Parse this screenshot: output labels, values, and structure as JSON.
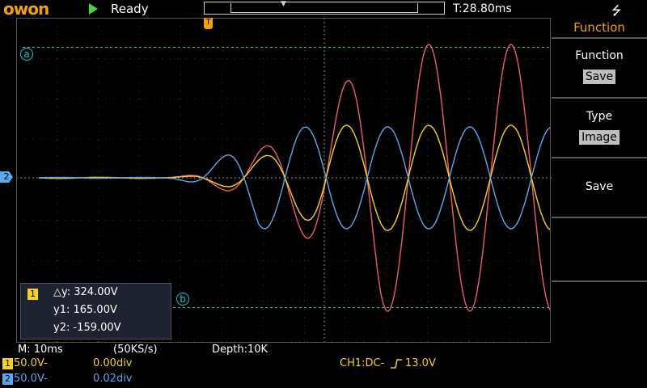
{
  "topbar": {
    "logo": "owon",
    "status": "Ready",
    "trigger_position_marker": "▼",
    "trigger_time": "T:28.80ms",
    "usb_icon": "usb-icon"
  },
  "menu": {
    "title": "Function",
    "items": [
      {
        "label": "Function",
        "value": "Save"
      },
      {
        "label": "Type",
        "value": "Image"
      },
      {
        "label": "Save",
        "value": ""
      }
    ]
  },
  "cursors": {
    "a_label": "a",
    "b_label": "b",
    "trigger_marker": "T",
    "ch2_marker": "2"
  },
  "measurement": {
    "channel": "1",
    "delta": "△y: 324.00V",
    "y1": "y1: 165.00V",
    "y2": "y2: -159.00V"
  },
  "status_line": {
    "timebase": "M: 10ms",
    "sample_rate": "(50KS/s)",
    "depth": "Depth:10K"
  },
  "channels": [
    {
      "id": "1",
      "scale": "50.0V-",
      "offset": "0.00div",
      "color": "#f7d21f"
    },
    {
      "id": "2",
      "scale": "50.0V-",
      "offset": "0.02div",
      "color": "#5aa9f0"
    }
  ],
  "trigger": {
    "text_prefix": "CH1:DC-",
    "text_value": "13.0V"
  },
  "colors": {
    "ch1": "#f7d21f",
    "ch2": "#5aa9f0",
    "math": "#f05a6e",
    "cursor": "#20c8c8",
    "accent": "#f2a10a"
  }
}
